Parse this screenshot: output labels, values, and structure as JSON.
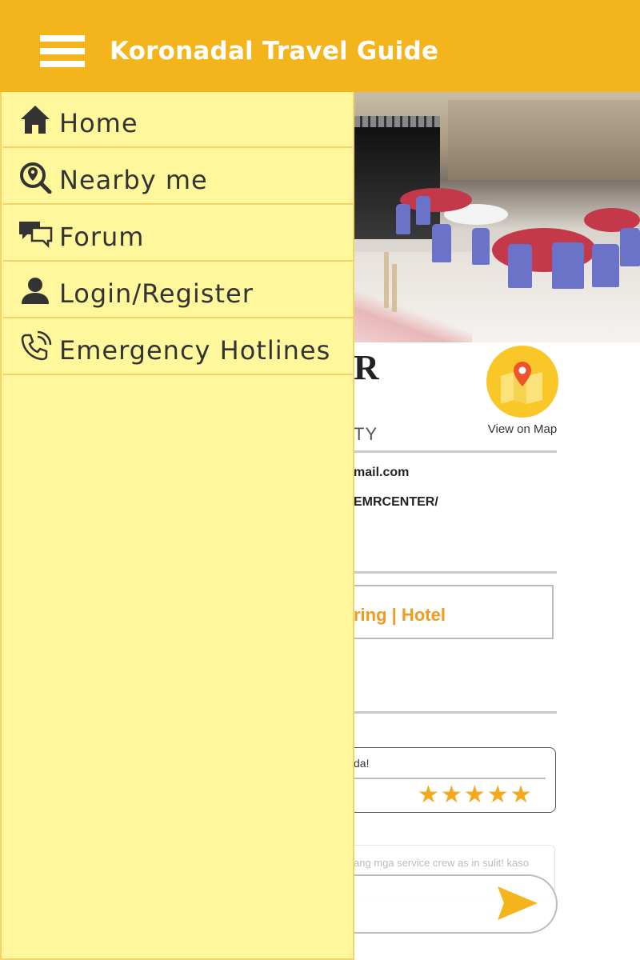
{
  "app": {
    "title": "Koronadal Travel Guide",
    "accent_color": "#f4b41c",
    "menu_icon": "hamburger-menu-icon"
  },
  "drawer": {
    "background": "#fff79b",
    "items": [
      {
        "label": "Home",
        "icon": "home-icon"
      },
      {
        "label": "Nearby me",
        "icon": "location-search-icon"
      },
      {
        "label": "Forum",
        "icon": "chat-bubbles-icon"
      },
      {
        "label": "Login/Register",
        "icon": "user-icon"
      },
      {
        "label": "Emergency Hotlines",
        "icon": "phone-call-icon"
      }
    ]
  },
  "place": {
    "name_fragment": "R",
    "type_fragment": "TY",
    "email_fragment": "mail.com",
    "facebook_fragment": "EMRCENTER/",
    "category_fragment": "ring | Hotel",
    "map_button_label": "View on Map",
    "map_icon": "map-pin-icon"
  },
  "reviews": {
    "items": [
      {
        "text_fragment": "da!",
        "rating": 5,
        "max_rating": 5
      }
    ]
  },
  "comment": {
    "text_fragment": "ang mga service crew as in sulit! kaso",
    "send_icon": "send-arrow-icon"
  }
}
